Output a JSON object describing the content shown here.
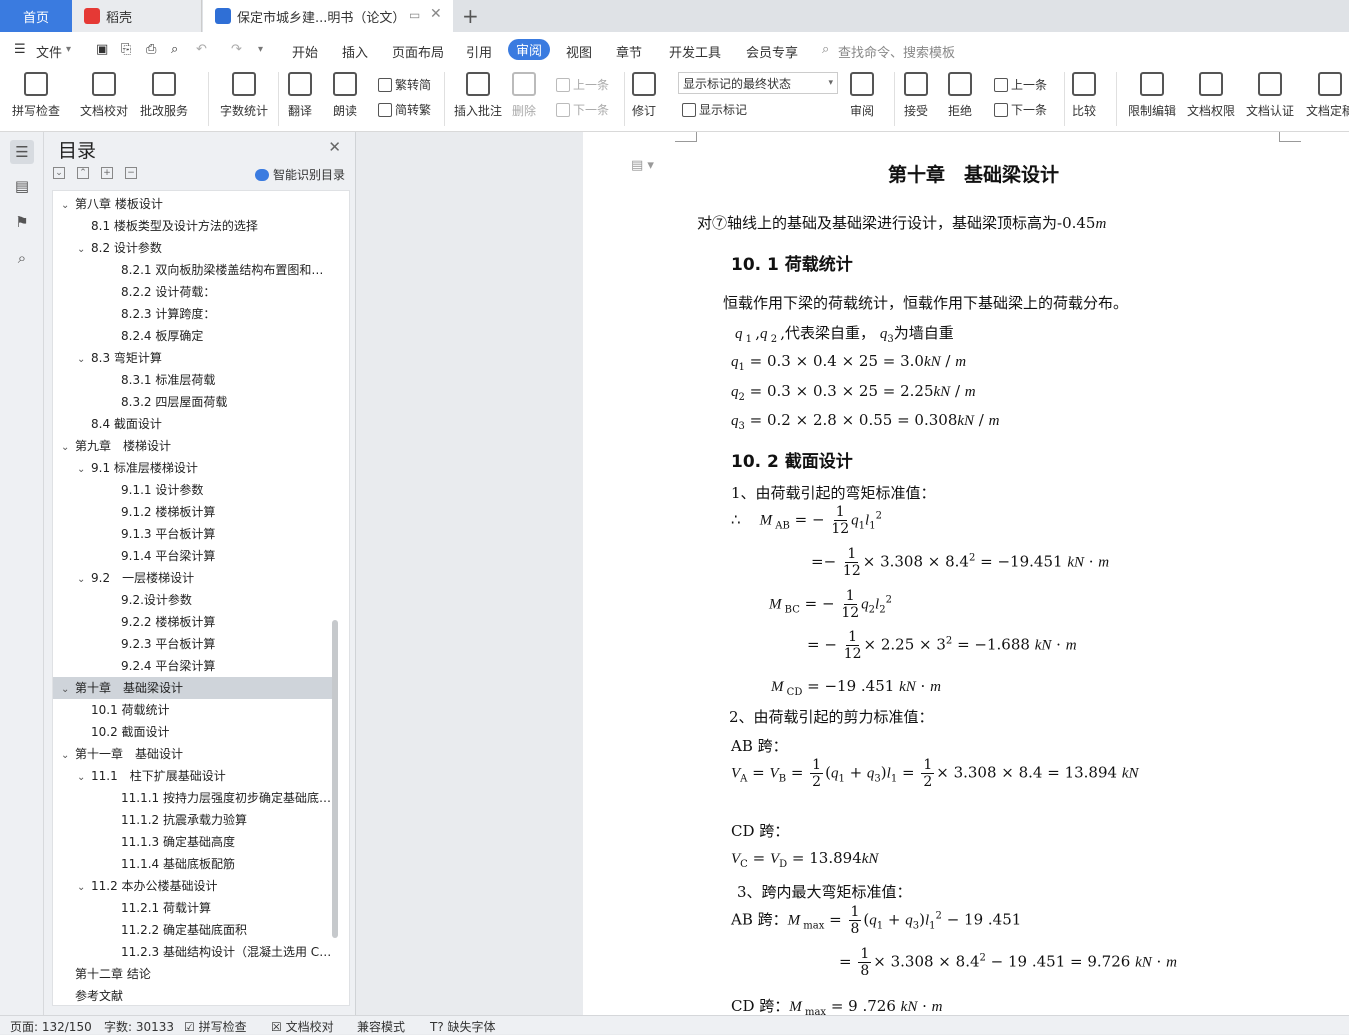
{
  "tabs": {
    "home": "首页",
    "daoke": "稻壳",
    "doc": "保定市城乡建...明书（论文）",
    "new_tab": "+"
  },
  "menu": {
    "file": "文件",
    "items": [
      "开始",
      "插入",
      "页面布局",
      "引用",
      "审阅",
      "视图",
      "章节",
      "开发工具",
      "会员专享"
    ],
    "active": "审阅",
    "search": "查找命令、搜索模板"
  },
  "toolbar": {
    "spell": "拼写检查",
    "proof": "文档校对",
    "annotate_service": "批改服务",
    "wordcount": "字数统计",
    "translate": "翻译",
    "read": "朗读",
    "trad": "繁转简",
    "simp": "简转繁",
    "insert_comment": "插入批注",
    "delete": "删除",
    "prev_comment": "上一条",
    "next_comment": "下一条",
    "revise": "修订",
    "show_mode": "显示标记的最终状态",
    "show_marks": "显示标记",
    "review": "审阅",
    "accept": "接受",
    "reject": "拒绝",
    "prev": "上一条",
    "next": "下一条",
    "compare": "比较",
    "restrict": "限制编辑",
    "permission": "文档权限",
    "certify": "文档认证",
    "finalize": "文档定稿"
  },
  "toc": {
    "title": "目录",
    "smart": "智能识别目录",
    "items": [
      {
        "t": "第八章 楼板设计",
        "lvl": 1,
        "arrow": true
      },
      {
        "t": "8.1 楼板类型及设计方法的选择",
        "lvl": 2,
        "arrow": false
      },
      {
        "t": "8.2 设计参数",
        "lvl": 2,
        "arrow": true
      },
      {
        "t": "8.2.1 双向板肋梁楼盖结构布置图和板…",
        "lvl": 3,
        "arrow": false
      },
      {
        "t": "8.2.2 设计荷载：",
        "lvl": 3,
        "arrow": false
      },
      {
        "t": "8.2.3 计算跨度：",
        "lvl": 3,
        "arrow": false
      },
      {
        "t": "8.2.4 板厚确定",
        "lvl": 3,
        "arrow": false
      },
      {
        "t": "8.3 弯矩计算",
        "lvl": 2,
        "arrow": true
      },
      {
        "t": "8.3.1 标准层荷载",
        "lvl": 3,
        "arrow": false
      },
      {
        "t": "8.3.2 四层屋面荷载",
        "lvl": 3,
        "arrow": false
      },
      {
        "t": "8.4 截面设计",
        "lvl": 2,
        "arrow": false
      },
      {
        "t": "第九章　楼梯设计",
        "lvl": 1,
        "arrow": true
      },
      {
        "t": "9.1 标准层楼梯设计",
        "lvl": 2,
        "arrow": true
      },
      {
        "t": "9.1.1 设计参数",
        "lvl": 3,
        "arrow": false
      },
      {
        "t": "9.1.2 楼梯板计算",
        "lvl": 3,
        "arrow": false
      },
      {
        "t": "9.1.3 平台板计算",
        "lvl": 3,
        "arrow": false
      },
      {
        "t": "9.1.4 平台梁计算",
        "lvl": 3,
        "arrow": false
      },
      {
        "t": "9.2　一层楼梯设计",
        "lvl": 2,
        "arrow": true
      },
      {
        "t": "9.2.设计参数",
        "lvl": 3,
        "arrow": false
      },
      {
        "t": "9.2.2 楼梯板计算",
        "lvl": 3,
        "arrow": false
      },
      {
        "t": "9.2.3 平台板计算",
        "lvl": 3,
        "arrow": false
      },
      {
        "t": "9.2.4 平台梁计算",
        "lvl": 3,
        "arrow": false
      },
      {
        "t": "第十章　基础梁设计",
        "lvl": 1,
        "arrow": true,
        "sel": true
      },
      {
        "t": "10.1 荷载统计",
        "lvl": 2,
        "arrow": false
      },
      {
        "t": "10.2 截面设计",
        "lvl": 2,
        "arrow": false
      },
      {
        "t": "第十一章　基础设计",
        "lvl": 1,
        "arrow": true
      },
      {
        "t": "11.1　柱下扩展基础设计",
        "lvl": 2,
        "arrow": true
      },
      {
        "t": "11.1.1 按持力层强度初步确定基础底…",
        "lvl": 3,
        "arrow": false
      },
      {
        "t": "11.1.2 抗震承载力验算",
        "lvl": 3,
        "arrow": false
      },
      {
        "t": "11.1.3 确定基础高度",
        "lvl": 3,
        "arrow": false
      },
      {
        "t": "11.1.4 基础底板配筋",
        "lvl": 3,
        "arrow": false
      },
      {
        "t": "11.2 本办公楼基础设计",
        "lvl": 2,
        "arrow": true
      },
      {
        "t": "11.2.1 荷载计算",
        "lvl": 3,
        "arrow": false
      },
      {
        "t": "11.2.2 确定基础底面积",
        "lvl": 3,
        "arrow": false
      },
      {
        "t": "11.2.3 基础结构设计（混凝土选用 C3…",
        "lvl": 3,
        "arrow": false
      },
      {
        "t": "第十二章 结论",
        "lvl": 1,
        "arrow": false
      },
      {
        "t": "参考文献",
        "lvl": 1,
        "arrow": false
      }
    ]
  },
  "doc": {
    "chapter": "第十章　基础梁设计",
    "intro": "对⑦轴线上的基础及基础梁进行设计，基础梁顶标高为-0.45",
    "intro_unit": "m",
    "s1": "10. 1 荷载统计",
    "s1_text": "恒载作用下梁的荷载统计，恒载作用下基础梁上的荷载分布。",
    "q_def_tail": "代表梁自重，",
    "q3_def_tail": "为墙自重",
    "q1": "= 0.3 × 0.4 × 25 = 3.0",
    "q2": "= 0.3 × 0.3 × 25 = 2.25",
    "q3": "= 0.2 × 2.8 × 0.55 = 0.308",
    "s2": "10. 2 截面设计",
    "item1": "1、由荷载引起的弯矩标准值：",
    "mab2": "× 3.308 × 8.4",
    "mab2_res": "= −19.451",
    "mbc2": "× 2.25 × 3",
    "mbc2_res": "= −1.688",
    "mcd": "= −19 .451",
    "item2": "2、由荷载引起的剪力标准值：",
    "ab_span": "AB 跨：",
    "va_tail": "× 3.308 × 8.4 = 13.894",
    "cd_span": "CD 跨：",
    "vc_tail": "= 13.894",
    "item3": "3、跨内最大弯矩标准值：",
    "mmax1_tail": "− 19 .451",
    "mmax2": "× 3.308 × 8.4",
    "mmax2_res": "− 19 .451 = 9.726",
    "cd_mmax": "= 9 .726"
  },
  "status": {
    "page": "页面: 132/150",
    "words": "字数: 30133",
    "spell": "拼写检查",
    "proof": "文档校对",
    "compat": "兼容模式",
    "font": "缺失字体"
  }
}
